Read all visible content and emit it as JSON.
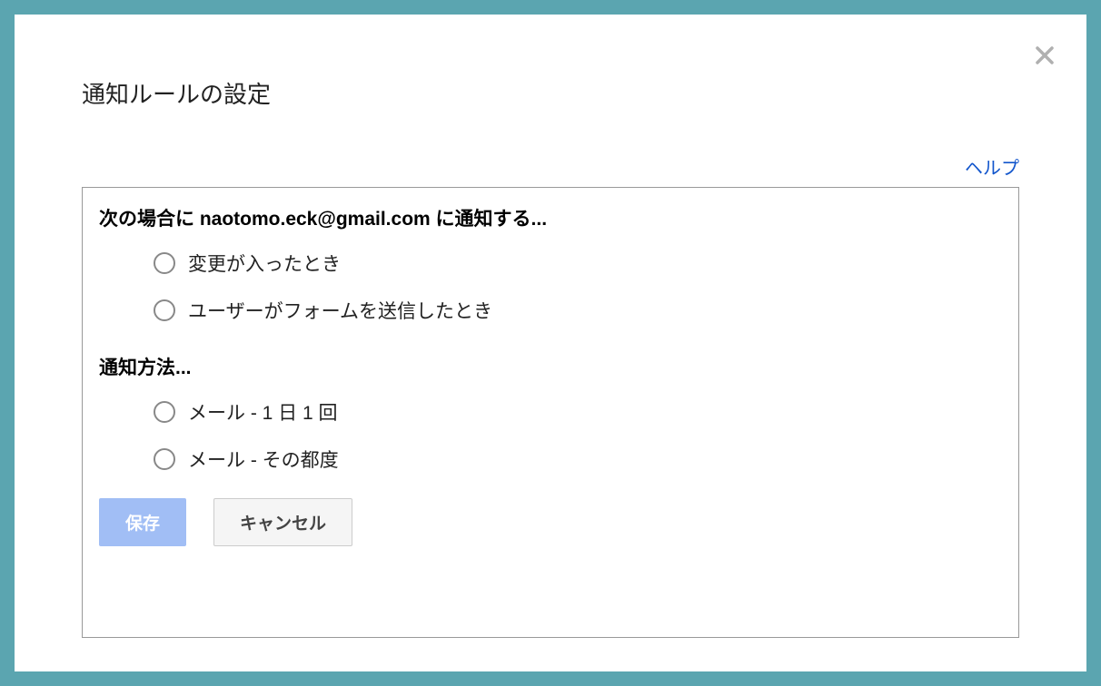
{
  "modal": {
    "title": "通知ルールの設定",
    "help_label": "ヘルプ",
    "section1_heading": "次の場合に naotomo.eck@gmail.com に通知する...",
    "section1_options": [
      {
        "label": "変更が入ったとき"
      },
      {
        "label": "ユーザーがフォームを送信したとき"
      }
    ],
    "section2_heading": "通知方法...",
    "section2_options": [
      {
        "label": "メール - 1 日 1 回"
      },
      {
        "label": "メール - その都度"
      }
    ],
    "buttons": {
      "save": "保存",
      "cancel": "キャンセル"
    }
  }
}
